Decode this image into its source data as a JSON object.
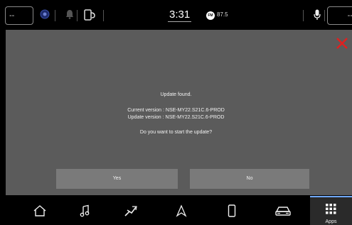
{
  "status_bar": {
    "temp_left": "--",
    "temp_right": "--",
    "time": "3:31",
    "radio_band": "FM",
    "radio_frequency": "87.5",
    "icons": [
      "driver-assist-icon",
      "bell-icon",
      "phone-projection-icon",
      "microphone-icon"
    ]
  },
  "dialog": {
    "title": "Update found.",
    "current_version": "Current version : NSE-MY22.S21C.6-PROD",
    "update_version": "Update version : NSE-MY22.S21C.6-PROD",
    "question": "Do you want to start the update?",
    "yes_label": "Yes",
    "no_label": "No",
    "close_color": "#e02020"
  },
  "nav": {
    "items": [
      "home-icon",
      "music-icon",
      "climate-icon",
      "navigation-icon",
      "phone-icon",
      "vehicle-icon"
    ],
    "apps_label": "Apps"
  }
}
